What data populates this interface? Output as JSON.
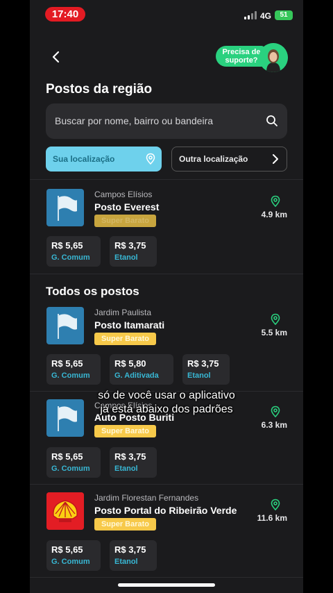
{
  "status_bar": {
    "time": "17:40",
    "network": "4G",
    "battery": "51"
  },
  "header": {
    "support_label": "Precisa de suporte?",
    "title": "Postos da região"
  },
  "search": {
    "placeholder": "Buscar por nome, bairro ou bandeira"
  },
  "location": {
    "own_label": "Sua localização",
    "other_label": "Outra localização"
  },
  "featured_station": {
    "district": "Campos Elísios",
    "name": "Posto Everest",
    "badge": "Super Barato",
    "distance": "4.9 km",
    "prices": [
      {
        "value": "R$ 5,65",
        "fuel": "G. Comum"
      },
      {
        "value": "R$ 3,75",
        "fuel": "Etanol"
      }
    ]
  },
  "all_stations": {
    "title": "Todos os postos",
    "items": [
      {
        "district": "Jardim Paulista",
        "name": "Posto Itamarati",
        "badge": "Super Barato",
        "distance": "5.5 km",
        "prices": [
          {
            "value": "R$ 5,65",
            "fuel": "G. Comum"
          },
          {
            "value": "R$ 5,80",
            "fuel": "G. Aditivada"
          },
          {
            "value": "R$ 3,75",
            "fuel": "Etanol"
          }
        ]
      },
      {
        "district": "Campos Elísios",
        "name": "Auto Posto Buriti",
        "badge": "Super Barato",
        "distance": "6.3 km",
        "prices": [
          {
            "value": "R$ 5,65",
            "fuel": "G. Comum"
          },
          {
            "value": "R$ 3,75",
            "fuel": "Etanol"
          }
        ]
      },
      {
        "district": "Jardim Florestan Fernandes",
        "name": "Posto Portal do Ribeirão Verde",
        "badge": "Super Barato",
        "distance": "11.6 km",
        "prices": [
          {
            "value": "R$ 5,65",
            "fuel": "G. Comum"
          },
          {
            "value": "R$ 3,75",
            "fuel": "Etanol"
          }
        ]
      }
    ]
  },
  "subtitles": {
    "line1": "só de você usar o aplicativo",
    "line2": "já está abaixo dos padrões"
  },
  "colors": {
    "accent_cyan": "#6ed1ec",
    "support_green": "#2ad17f",
    "badge_yellow": "#f7c94a",
    "fuel_blue": "#38b7d4"
  }
}
